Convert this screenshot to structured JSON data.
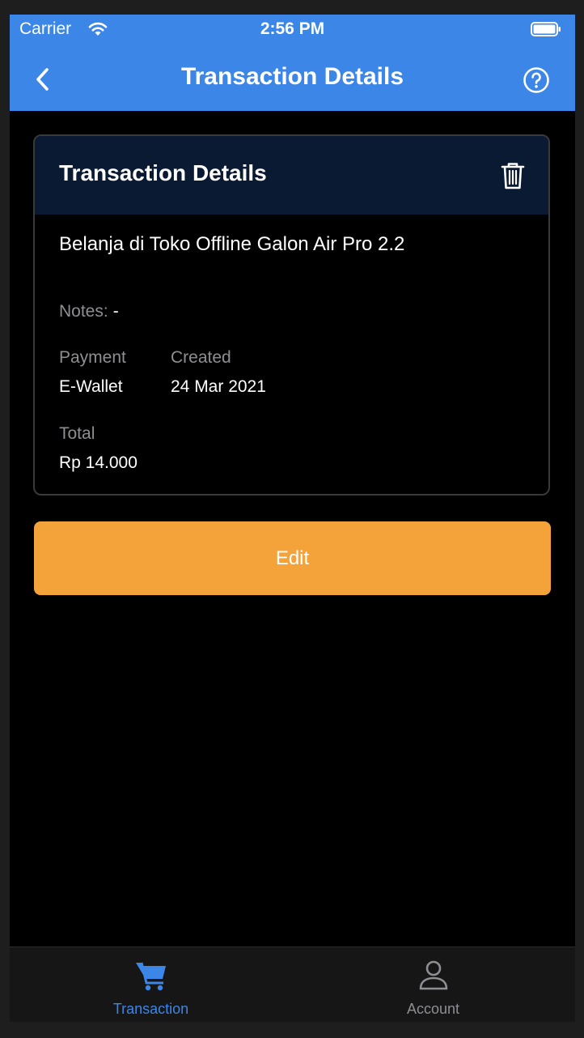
{
  "status_bar": {
    "carrier": "Carrier",
    "time": "2:56 PM"
  },
  "nav": {
    "title": "Transaction Details"
  },
  "card": {
    "title": "Transaction Details",
    "description": "Belanja di Toko Offline Galon Air Pro 2.2",
    "notes_label": "Notes:",
    "notes_value": "-",
    "payment_label": "Payment",
    "payment_value": "E-Wallet",
    "created_label": "Created",
    "created_value": "24 Mar 2021",
    "total_label": "Total",
    "total_value": "Rp 14.000"
  },
  "actions": {
    "edit_label": "Edit"
  },
  "tabbar": {
    "items": [
      {
        "label": "Transaction",
        "icon": "cart-icon",
        "active": true
      },
      {
        "label": "Account",
        "icon": "person-icon",
        "active": false
      }
    ]
  },
  "colors": {
    "accent": "#3b86e6",
    "edit_button": "#f4a33b",
    "card_header": "#0b1a33",
    "tab_active": "#3b86e6",
    "tab_inactive": "#8e8e93"
  }
}
